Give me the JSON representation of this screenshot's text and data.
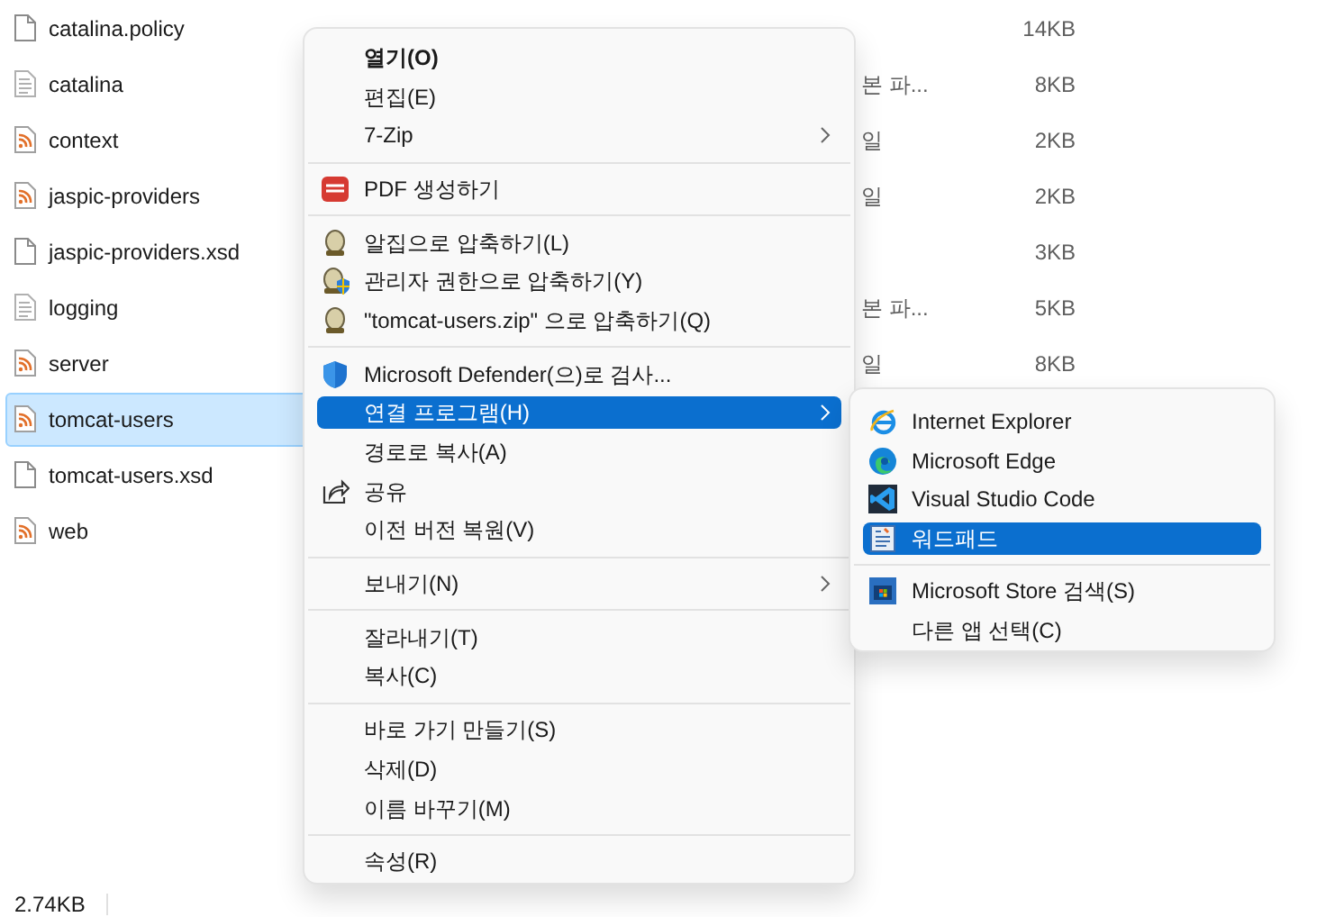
{
  "files": [
    {
      "name": "catalina.policy",
      "kind": "blank",
      "selected": false,
      "size": "14KB"
    },
    {
      "name": "catalina",
      "kind": "text",
      "selected": false,
      "type": "본 파...",
      "size": "8KB"
    },
    {
      "name": "context",
      "kind": "xml",
      "selected": false,
      "type": "일",
      "size": "2KB"
    },
    {
      "name": "jaspic-providers",
      "kind": "xml",
      "selected": false,
      "type": "일",
      "size": "2KB"
    },
    {
      "name": "jaspic-providers.xsd",
      "kind": "blank",
      "selected": false,
      "size": "3KB"
    },
    {
      "name": "logging",
      "kind": "text",
      "selected": false,
      "type": "본 파...",
      "size": "5KB"
    },
    {
      "name": "server",
      "kind": "xml",
      "selected": false,
      "type": "일",
      "size": "8KB"
    },
    {
      "name": "tomcat-users",
      "kind": "xml",
      "selected": true
    },
    {
      "name": "tomcat-users.xsd",
      "kind": "blank",
      "selected": false
    },
    {
      "name": "web",
      "kind": "xml",
      "selected": false
    }
  ],
  "context_menu": {
    "items": [
      {
        "kind": "item",
        "label": "열기(O)",
        "default": true,
        "submenu": false,
        "selected": false
      },
      {
        "kind": "item",
        "label": "편집(E)",
        "default": false,
        "submenu": false,
        "selected": false
      },
      {
        "kind": "item",
        "label": "7-Zip",
        "default": false,
        "submenu": true,
        "selected": false
      },
      {
        "kind": "separator"
      },
      {
        "kind": "pdf",
        "label": "PDF 생성하기",
        "default": false,
        "submenu": false,
        "selected": false
      },
      {
        "kind": "separator"
      },
      {
        "kind": "egg",
        "label": "알집으로 압축하기(L)",
        "default": false,
        "submenu": false,
        "selected": false
      },
      {
        "kind": "egg_shield",
        "label": "관리자 권한으로 압축하기(Y)",
        "default": false,
        "submenu": false,
        "selected": false
      },
      {
        "kind": "egg",
        "label": "\"tomcat-users.zip\" 으로 압축하기(Q)",
        "default": false,
        "submenu": false,
        "selected": false
      },
      {
        "kind": "separator"
      },
      {
        "kind": "shield",
        "label": "Microsoft Defender(으)로 검사...",
        "default": false,
        "submenu": false,
        "selected": false
      },
      {
        "kind": "item",
        "label": "연결 프로그램(H)",
        "default": false,
        "submenu": true,
        "selected": true
      },
      {
        "kind": "item",
        "label": "경로로 복사(A)",
        "default": false,
        "submenu": false,
        "selected": false
      },
      {
        "kind": "share",
        "label": "공유",
        "default": false,
        "submenu": false,
        "selected": false
      },
      {
        "kind": "item",
        "label": "이전 버전 복원(V)",
        "default": false,
        "submenu": false,
        "selected": false
      },
      {
        "kind": "separator"
      },
      {
        "kind": "item",
        "label": "보내기(N)",
        "default": false,
        "submenu": true,
        "selected": false
      },
      {
        "kind": "separator"
      },
      {
        "kind": "item",
        "label": "잘라내기(T)",
        "default": false,
        "submenu": false,
        "selected": false
      },
      {
        "kind": "item",
        "label": "복사(C)",
        "default": false,
        "submenu": false,
        "selected": false
      },
      {
        "kind": "separator"
      },
      {
        "kind": "item",
        "label": "바로 가기 만들기(S)",
        "default": false,
        "submenu": false,
        "selected": false
      },
      {
        "kind": "item",
        "label": "삭제(D)",
        "default": false,
        "submenu": false,
        "selected": false
      },
      {
        "kind": "item",
        "label": "이름 바꾸기(M)",
        "default": false,
        "submenu": false,
        "selected": false
      },
      {
        "kind": "separator"
      },
      {
        "kind": "item",
        "label": "속성(R)",
        "default": false,
        "submenu": false,
        "selected": false
      }
    ]
  },
  "open_with_menu": {
    "items": [
      {
        "kind": "ie",
        "label": "Internet Explorer",
        "selected": false
      },
      {
        "kind": "edge",
        "label": "Microsoft Edge",
        "selected": false
      },
      {
        "kind": "vscode",
        "label": "Visual Studio Code",
        "selected": false
      },
      {
        "kind": "wordpad",
        "label": "워드패드",
        "selected": true
      },
      {
        "kind": "separator"
      },
      {
        "kind": "store",
        "label": "Microsoft Store 검색(S)",
        "selected": false
      },
      {
        "kind": "item",
        "label": "다른 앱 선택(C)",
        "selected": false
      }
    ]
  },
  "status_bar": {
    "size": "2.74KB"
  }
}
